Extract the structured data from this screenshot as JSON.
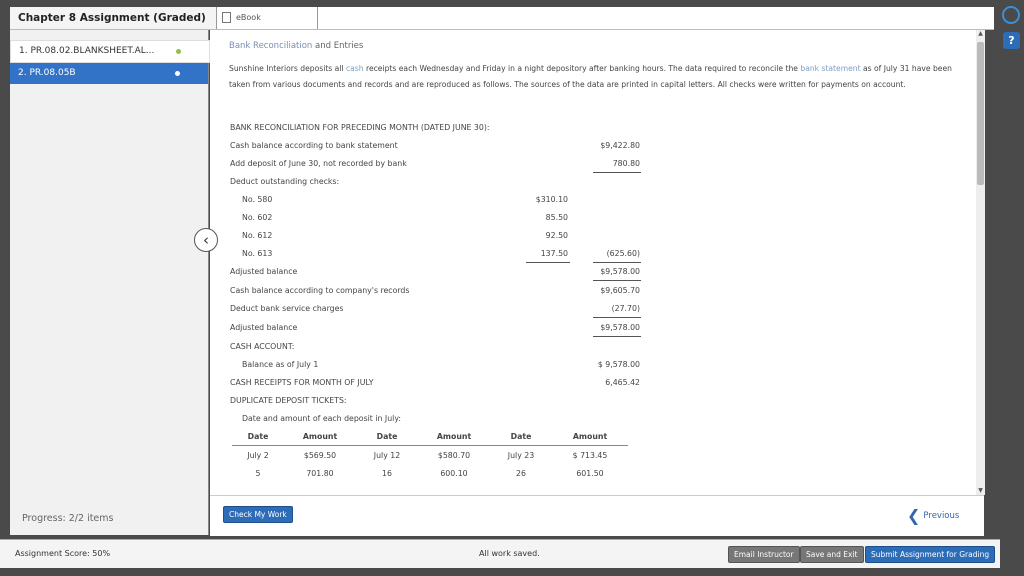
{
  "header": {
    "assignment_title": "Chapter 8 Assignment (Graded)",
    "ebook_tab": "eBook"
  },
  "sidebar": {
    "items": [
      {
        "label": "1. PR.08.02.BLANKSHEET.AL..."
      },
      {
        "label": "2. PR.08.05B"
      }
    ],
    "progress": "Progress: 2/2 items"
  },
  "content": {
    "title_prefix": "Bank Reconciliation",
    "title_suffix": "and Entries",
    "para_part1": "Sunshine Interiors deposits all",
    "para_link1": "cash",
    "para_part2": "receipts each Wednesday and Friday in a night depository after banking hours. The data required to reconcile the",
    "para_link2": "bank statement",
    "para_part3": "as of July 31 have been taken from various documents and records and are reproduced as follows. The sources of the data are printed in capital letters. All checks were written for payments on account.",
    "recon": {
      "heading": "BANK RECONCILIATION FOR PRECEDING MONTH (DATED JUNE 30):",
      "cash_bank": "Cash balance according to bank statement",
      "cash_bank_val": "$9,422.80",
      "add_deposit": "Add deposit of June 30, not recorded by bank",
      "add_deposit_val": "780.80",
      "deduct_checks": "Deduct outstanding checks:",
      "checks": [
        {
          "no": "No. 580",
          "amt": "$310.10"
        },
        {
          "no": "No. 602",
          "amt": "85.50"
        },
        {
          "no": "No. 612",
          "amt": "92.50"
        },
        {
          "no": "No. 613",
          "amt": "137.50"
        }
      ],
      "checks_total": "(625.60)",
      "adjusted": "Adjusted balance",
      "adjusted_val": "$9,578.00",
      "cash_company": "Cash balance according to company's records",
      "cash_company_val": "$9,605.70",
      "deduct_service": "Deduct bank service charges",
      "deduct_service_val": "(27.70)",
      "adjusted2": "Adjusted balance",
      "adjusted2_val": "$9,578.00"
    },
    "cash_account": {
      "heading": "CASH ACCOUNT:",
      "balance_label": "Balance as of July 1",
      "balance_val": "$ 9,578.00",
      "receipts_label": "CASH RECEIPTS FOR MONTH OF JULY",
      "receipts_val": "6,465.42",
      "dup_heading": "DUPLICATE DEPOSIT TICKETS:",
      "date_amount_label": "Date and amount of each deposit in July:"
    },
    "deposits": {
      "headers": [
        "Date",
        "Amount",
        "Date",
        "Amount",
        "Date",
        "Amount"
      ],
      "rows": [
        [
          "July 2",
          "$569.50",
          "July 12",
          "$580.70",
          "July 23",
          "$ 713.45"
        ],
        [
          "5",
          "701.80",
          "16",
          "600.10",
          "26",
          "601.50"
        ]
      ]
    }
  },
  "actions": {
    "check_my_work": "Check My Work",
    "previous": "Previous"
  },
  "status": {
    "score": "Assignment Score: 50%",
    "saved": "All work saved.",
    "email": "Email Instructor",
    "save_exit": "Save and Exit",
    "submit": "Submit Assignment for Grading"
  },
  "colors": {
    "accent": "#3273c7",
    "check_dot": "#8ac24a"
  }
}
